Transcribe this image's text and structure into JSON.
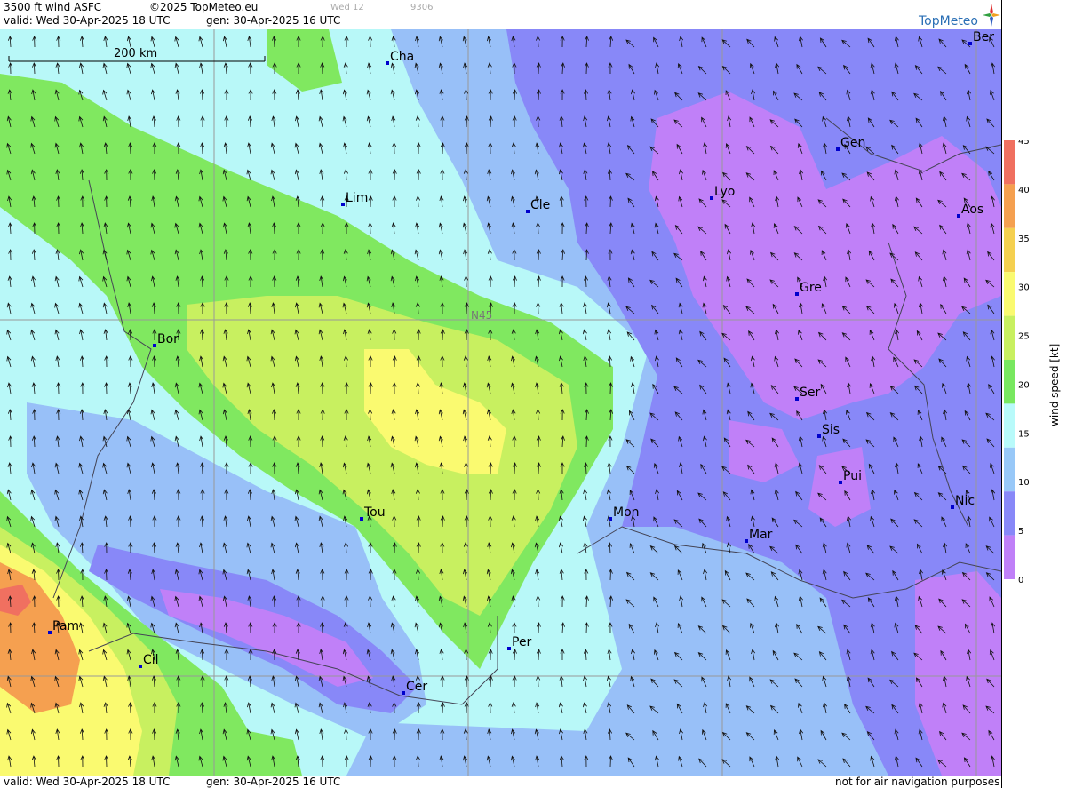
{
  "header": {
    "product": "3500 ft wind ASFC",
    "copyright": "©2025 TopMeteo.eu",
    "faint1": "Wed 12",
    "faint2": "9306",
    "valid": "valid:  Wed  30-Apr-2025  18 UTC",
    "gen": "gen: 30-Apr-2025 16 UTC",
    "logo_text": "TopMeteo"
  },
  "footer": {
    "valid": "valid:  Wed  30-Apr-2025  18 UTC",
    "gen": "gen: 30-Apr-2025 16 UTC",
    "disclaimer": "not for air navigation purposes"
  },
  "map": {
    "scale_label": "200 km",
    "lat_label": "N45",
    "cities": [
      {
        "name": "Cha"
      },
      {
        "name": "Ber"
      },
      {
        "name": "Gen"
      },
      {
        "name": "Lim"
      },
      {
        "name": "Cle"
      },
      {
        "name": "Lyo"
      },
      {
        "name": "Aos"
      },
      {
        "name": "Gre"
      },
      {
        "name": "Bor"
      },
      {
        "name": "Ser"
      },
      {
        "name": "Sis"
      },
      {
        "name": "Pui"
      },
      {
        "name": "Tou"
      },
      {
        "name": "Mon"
      },
      {
        "name": "Mar"
      },
      {
        "name": "Nic"
      },
      {
        "name": "Pam"
      },
      {
        "name": "Cil"
      },
      {
        "name": "Per"
      },
      {
        "name": "Cer"
      }
    ]
  },
  "legend": {
    "title": "wind speed [kt]",
    "ticks": [
      "45",
      "40",
      "35",
      "30",
      "25",
      "20",
      "15",
      "10",
      "5",
      "0"
    ],
    "colors": [
      "#f07060",
      "#f5a050",
      "#f5d050",
      "#fafa70",
      "#c8f060",
      "#78e860",
      "#b8fafa",
      "#98c8f8",
      "#8888f8",
      "#c080f8"
    ]
  },
  "colors": {
    "purple": "#c080f8",
    "violet": "#8888f8",
    "blue": "#98c0f8",
    "cyan": "#b8f8f8",
    "green": "#80e860",
    "yellowgreen": "#c8f060",
    "yellow": "#fafa70",
    "orange": "#f5a050",
    "red": "#f07060"
  }
}
